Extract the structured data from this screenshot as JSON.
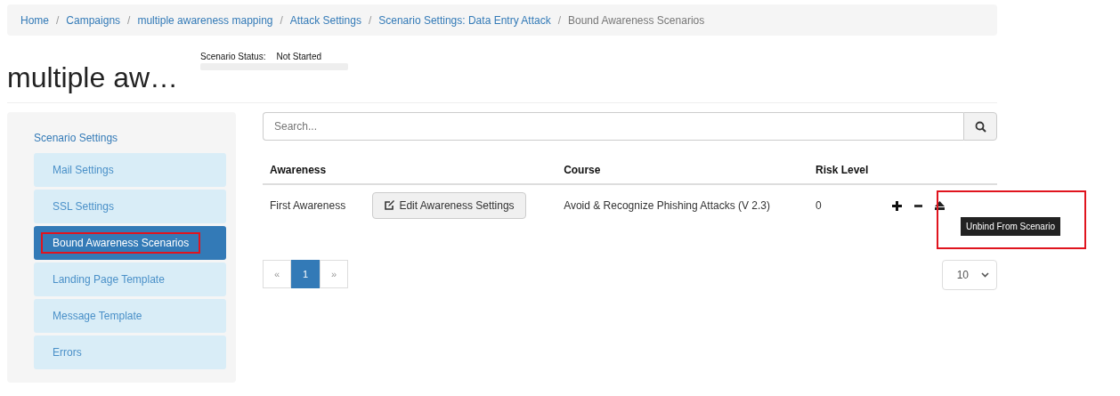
{
  "breadcrumb": [
    {
      "label": "Home",
      "current": false
    },
    {
      "label": "Campaigns",
      "current": false
    },
    {
      "label": "multiple awareness mapping",
      "current": false
    },
    {
      "label": "Attack Settings",
      "current": false
    },
    {
      "label": "Scenario Settings: Data Entry Attack",
      "current": false
    },
    {
      "label": "Bound Awareness Scenarios",
      "current": true
    }
  ],
  "breadcrumb_separator": "/",
  "page_title": "multiple aw…",
  "status": {
    "label": "Scenario Status:",
    "value": "Not Started"
  },
  "sidebar": {
    "heading": "Scenario Settings",
    "items": [
      {
        "label": "Mail Settings",
        "selected": false,
        "highlighted": false
      },
      {
        "label": "SSL Settings",
        "selected": false,
        "highlighted": false
      },
      {
        "label": "Bound Awareness Scenarios",
        "selected": true,
        "highlighted": true
      },
      {
        "label": "Landing Page Template",
        "selected": false,
        "highlighted": false
      },
      {
        "label": "Message Template",
        "selected": false,
        "highlighted": false
      },
      {
        "label": "Errors",
        "selected": false,
        "highlighted": false
      }
    ]
  },
  "search": {
    "placeholder": "Search..."
  },
  "table": {
    "columns": [
      "Awareness",
      "Course",
      "Risk Level"
    ],
    "rows": [
      {
        "awareness": "First Awareness",
        "edit_button": "Edit Awareness Settings",
        "course": "Avoid & Recognize Phishing Attacks (V 2.3)",
        "risk_level": "0",
        "tooltip": "Unbind From Scenario"
      }
    ]
  },
  "pagination": {
    "prev": "«",
    "next": "»",
    "pages": [
      {
        "label": "1",
        "selected": true
      }
    ]
  },
  "page_size": "10"
}
